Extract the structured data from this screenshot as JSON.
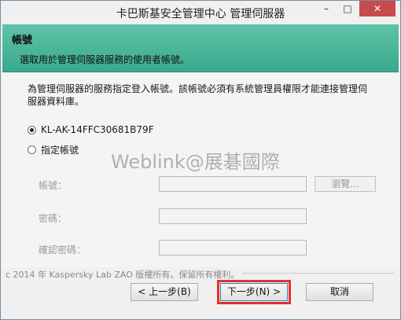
{
  "window": {
    "title": "卡巴斯基安全管理中心 管理伺服器",
    "min_icon": "minimize-icon",
    "max_icon": "maximize-icon",
    "close_icon": "close-icon"
  },
  "header": {
    "title": "帳號",
    "subtitle": "選取用於管理伺服器服務的使用者帳號。",
    "color": "#4cb89b"
  },
  "content": {
    "description": "為管理伺服器的服務指定登入帳號。該帳號必須有系統管理員權限才能連接管理伺服器資料庫。",
    "options": [
      {
        "label": "KL-AK-14FFC30681B79F",
        "checked": true
      },
      {
        "label": "指定帳號",
        "checked": false
      }
    ],
    "fields": {
      "account_label": "帳號：",
      "account_value": "",
      "browse_label": "瀏覽...",
      "password_label": "密碼：",
      "password_value": "",
      "confirm_label": "確認密碼：",
      "confirm_value": ""
    },
    "watermark": "Weblink@展碁國際"
  },
  "footer": {
    "copyright": "c 2014 年 Kaspersky Lab ZAO 版權所有。保留所有權利。",
    "back_label": "< 上一步(B)",
    "next_label": "下一步(N) >",
    "cancel_label": "取消",
    "highlight_color": "#e0312f"
  }
}
